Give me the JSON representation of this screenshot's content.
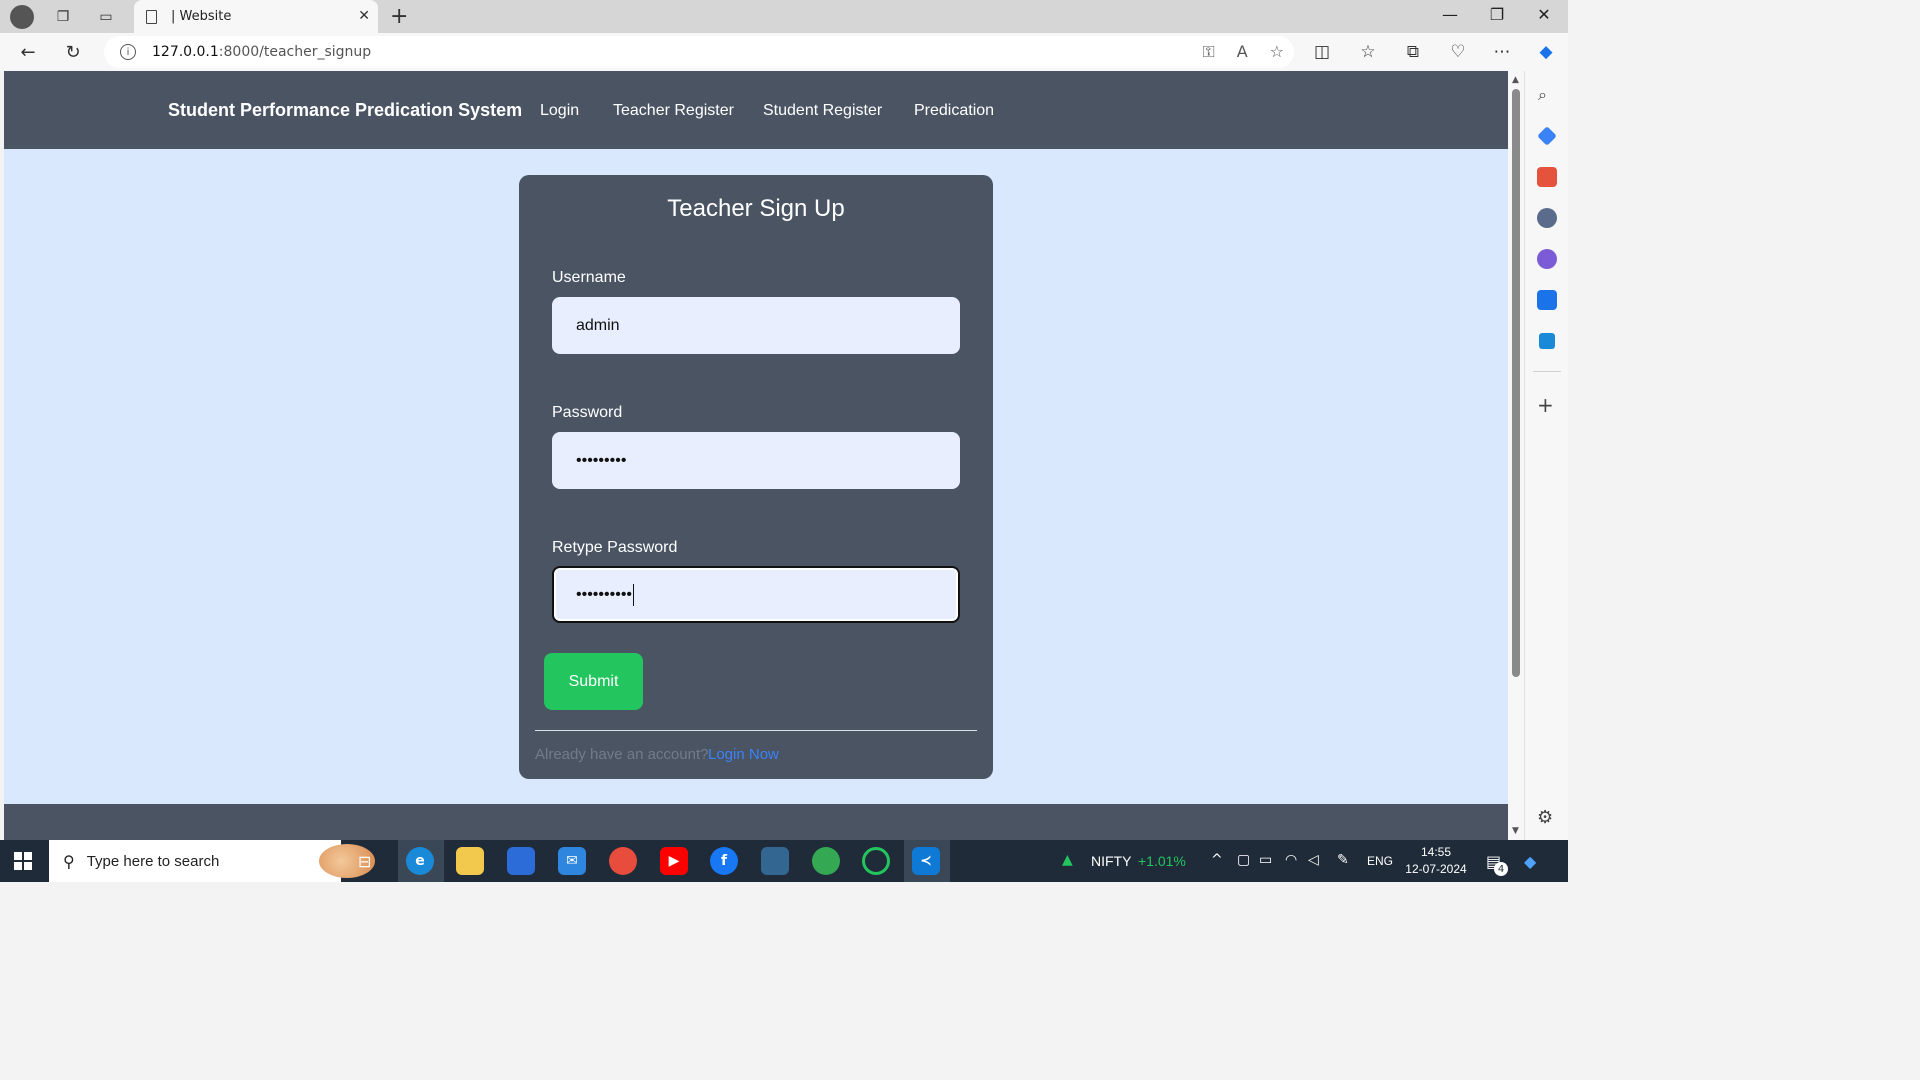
{
  "browser": {
    "tab_title": "| Website",
    "url_host": "127.0.0.1",
    "url_rest": ":8000/teacher_signup"
  },
  "navbar": {
    "brand": "Student Performance Predication System",
    "links": [
      "Login",
      "Teacher Register",
      "Student Register",
      "Predication"
    ]
  },
  "form": {
    "title": "Teacher Sign Up",
    "username_label": "Username",
    "username_value": "admin",
    "password_label": "Password",
    "password_value": "•••••••••",
    "retype_label": "Retype Password",
    "retype_value": "••••••••••",
    "submit_label": "Submit",
    "footer_text": "Already have an account?",
    "footer_link": "Login Now"
  },
  "taskbar": {
    "search_placeholder": "Type here to search",
    "nifty_label": "NIFTY",
    "nifty_change": "+1.01%",
    "language": "ENG",
    "time": "14:55",
    "date": "12-07-2024",
    "notification_count": "4"
  },
  "colors": {
    "navbar_bg": "#4a5463",
    "page_bg": "#d9e8fd",
    "submit_bg": "#22c55e",
    "link": "#3b82f6"
  }
}
